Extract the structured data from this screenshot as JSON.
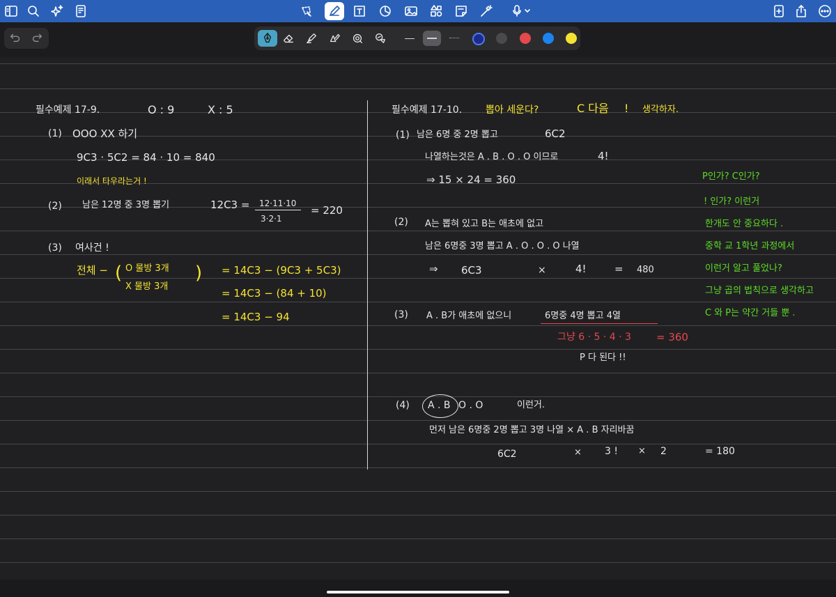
{
  "colors": {
    "topbar": "#2a60b8",
    "canvas": "#202022",
    "white_ink": "#e6e6e6",
    "yellow_ink": "#f5e332",
    "green_ink": "#5edb28",
    "red_ink": "#e5484d",
    "swatch_navy": "#1e2a8c",
    "swatch_gray": "#4a4a4c",
    "swatch_red": "#e5484d",
    "swatch_blue": "#1a84f0",
    "swatch_yellow": "#f5e332"
  },
  "icons": {
    "top_left": [
      "sidebar-icon",
      "search-icon",
      "sparkle-icon",
      "document-icon"
    ],
    "top_center": [
      "lasso-icon",
      "pen-icon",
      "text-box-icon",
      "shapes-icon",
      "image-icon",
      "elements-icon",
      "sticky-note-icon",
      "magic-wand-icon",
      "microphone-icon"
    ],
    "top_right": [
      "new-page-icon",
      "share-icon",
      "more-icon"
    ]
  },
  "left": {
    "title": "필수예제 17-9.",
    "o_ratio": "O : 9",
    "x_ratio": "X : 5",
    "p1": {
      "num": "(1)",
      "text": "OOO  XX  하기",
      "calc": "9C3 · 5C2  =  84 · 10 = 840",
      "note": "이래서 타우라는거 !"
    },
    "p2": {
      "num": "(2)",
      "text": "남은 12명 중  3명 뽑기",
      "calc": "12C3 =",
      "frac_num": "12·11·10",
      "frac_den": "3·2·1",
      "result": "= 220"
    },
    "p3": {
      "num": "(3)",
      "text": "여사건 !",
      "label": "전체 −",
      "case1": "O 물방  3개",
      "case2": "X 물방   3개",
      "eq1": "=  14C3 − (9C3 + 5C3)",
      "eq2": "=  14C3  −  (84 + 10)",
      "eq3": "=  14C3   −  94"
    }
  },
  "right": {
    "title": "필수예제 17-10.",
    "title_y": "뽑아 세운다?",
    "title_c": "C 다음",
    "title_mark": "!",
    "title_end": "생각하자.",
    "p1": {
      "num": "(1)",
      "text": "남은 6명 중  2명 뽑고",
      "sym": "6C2",
      "line2": "나열하는것은   A . B . O . O   이므로",
      "fact": "4!",
      "line3": "⇒  15 × 24  =  360"
    },
    "p2": {
      "num": "(2)",
      "text": "A는 뽑혀 있고     B는 애초에 없고",
      "line2": "남은 6명중   3명 뽑고       A . O . O . O 나열",
      "arrow": "⇒",
      "sym": "6C3",
      "times": "×",
      "fact": "4!",
      "eq": "=",
      "result": "480"
    },
    "p3": {
      "num": "(3)",
      "text": "A . B가  애초에 없으니",
      "under": "6명중 4명 뽑고  4열",
      "red_left": "그냥   6 · 5 · 4 · 3",
      "red_right": "= 360",
      "note": "P 다 된다 !!"
    },
    "p4": {
      "num": "(4)",
      "circled": "A . B",
      "rest": "O . O",
      "after": "이런거.",
      "line2": "먼저 남은    6명중    2명 뽑고        3명 나열  ×   A . B  자리바꿈",
      "sym": "6C2",
      "times1": "×",
      "fact": "3 !",
      "times2": "×",
      "two": "2",
      "result": "= 180"
    }
  },
  "green_notes": [
    "P인가?  C인가?",
    "! 인가?     이런거",
    "한개도 안 중요하다 .",
    "중학 교 1학년  과정에서",
    "이런거  알고  풀었나?",
    "그냥 곱의 법칙으로  생각하고",
    "C 와 P는   약간  거들 뿐 ."
  ]
}
